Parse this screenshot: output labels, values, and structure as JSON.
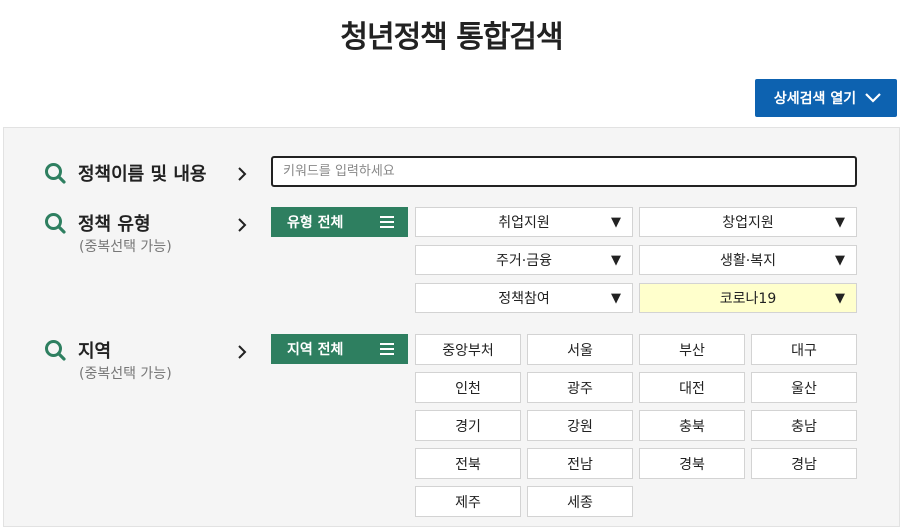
{
  "header": {
    "title": "청년정책 통합검색"
  },
  "detail_search": {
    "label": "상세검색 열기",
    "icon": "chevron-down-icon"
  },
  "keyword": {
    "label": "정책이름 및 내용",
    "placeholder": "키워드를 입력하세요",
    "value": ""
  },
  "policy_type": {
    "label": "정책 유형",
    "hint": "(중복선택 가능)",
    "all_label": "유형 전체",
    "options": [
      {
        "label": "취업지원"
      },
      {
        "label": "창업지원"
      },
      {
        "label": "주거·금융"
      },
      {
        "label": "생활·복지"
      },
      {
        "label": "정책참여"
      },
      {
        "label": "코로나19",
        "highlighted": true
      }
    ]
  },
  "region": {
    "label": "지역",
    "hint": "(중복선택 가능)",
    "all_label": "지역 전체",
    "options": [
      "중앙부처",
      "서울",
      "부산",
      "대구",
      "인천",
      "광주",
      "대전",
      "울산",
      "경기",
      "강원",
      "충북",
      "충남",
      "전북",
      "전남",
      "경북",
      "경남",
      "제주",
      "세종"
    ]
  },
  "colors": {
    "accent_green": "#2e7f60",
    "button_blue": "#0d62b0",
    "highlight_yellow": "#ffffcc"
  }
}
